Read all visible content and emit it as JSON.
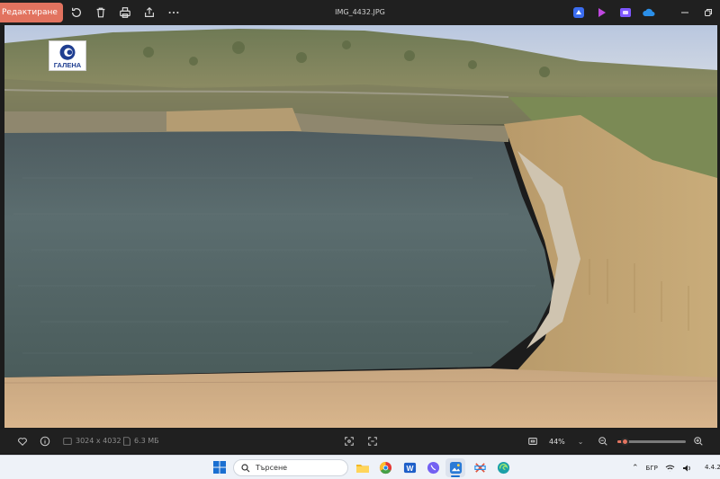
{
  "titlebar": {
    "edit_label": "Редактиране",
    "file_name": "IMG_4432.JPG",
    "actions": [
      "rotate-icon",
      "delete-icon",
      "print-icon",
      "share-icon",
      "more-icon"
    ],
    "apps": [
      "clipchamp-icon",
      "designer-icon",
      "copilot-icon",
      "onedrive-icon"
    ],
    "window_controls": [
      "minimize-icon",
      "restore-icon"
    ]
  },
  "photo": {
    "watermark_text": "ГАЛЕНА"
  },
  "bottombar": {
    "dimensions": "3024 x 4032",
    "file_size": "6.3 МБ",
    "zoom": "44%",
    "zoom_level": 0.1
  },
  "taskbar": {
    "search_placeholder": "Търсене",
    "language": "БГР",
    "date": "4.4.20",
    "accent": "#1a6fd1"
  },
  "colors": {
    "accent": "#e2735f",
    "chrome": "#202020"
  }
}
